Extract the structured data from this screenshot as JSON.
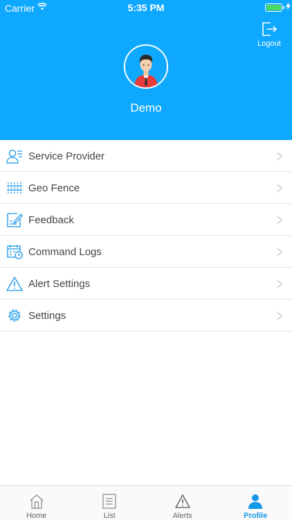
{
  "status_bar": {
    "carrier": "Carrier",
    "time": "5:35 PM"
  },
  "header": {
    "logout_label": "Logout",
    "username": "Demo",
    "background_color": "#0fa8ff"
  },
  "menu": {
    "items": [
      {
        "label": "Service Provider",
        "icon": "service-provider-icon"
      },
      {
        "label": "Geo Fence",
        "icon": "geo-fence-icon"
      },
      {
        "label": "Feedback",
        "icon": "feedback-icon"
      },
      {
        "label": "Command Logs",
        "icon": "command-logs-icon"
      },
      {
        "label": "Alert Settings",
        "icon": "alert-settings-icon"
      },
      {
        "label": "Settings",
        "icon": "settings-gear-icon"
      }
    ]
  },
  "tabbar": {
    "tabs": [
      {
        "label": "Home",
        "icon": "home-icon"
      },
      {
        "label": "List",
        "icon": "list-icon"
      },
      {
        "label": "Alerts",
        "icon": "alerts-icon"
      },
      {
        "label": "Profile",
        "icon": "profile-icon",
        "active": true
      }
    ],
    "active_color": "#1598e8"
  }
}
